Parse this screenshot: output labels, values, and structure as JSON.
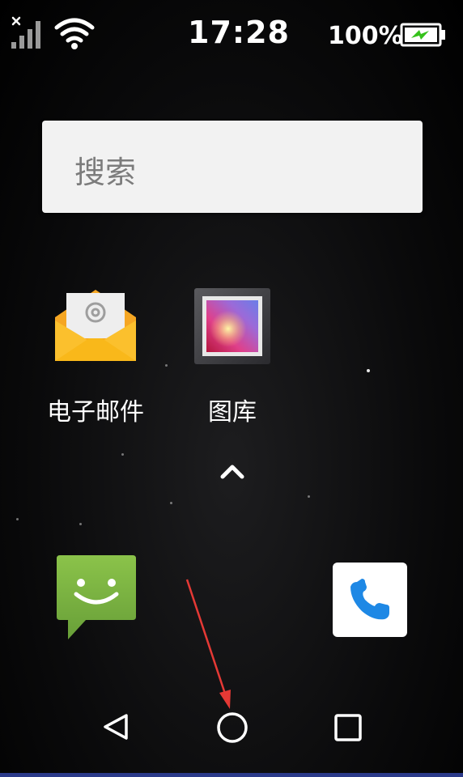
{
  "status_bar": {
    "time": "17:28",
    "battery_percent": "100%",
    "signal_icon": "signal-no-service-icon",
    "wifi_icon": "wifi-icon",
    "battery_icon": "battery-charging-icon",
    "battery_level": 1.0,
    "battery_bolt_color": "#35c21b"
  },
  "search": {
    "placeholder": "搜索"
  },
  "apps": [
    {
      "label": "电子邮件",
      "icon": "email-icon"
    },
    {
      "label": "图库",
      "icon": "gallery-icon"
    }
  ],
  "dock": [
    {
      "icon": "messaging-icon",
      "color": "#7cb342"
    },
    {
      "icon": "phone-icon",
      "color": "#1e88e5"
    }
  ],
  "app_drawer_icon": "chevron-up-icon",
  "nav": {
    "back_icon": "back-icon",
    "home_icon": "home-icon",
    "recents_icon": "recents-icon"
  },
  "annotation": {
    "arrow_color": "#e53935"
  }
}
